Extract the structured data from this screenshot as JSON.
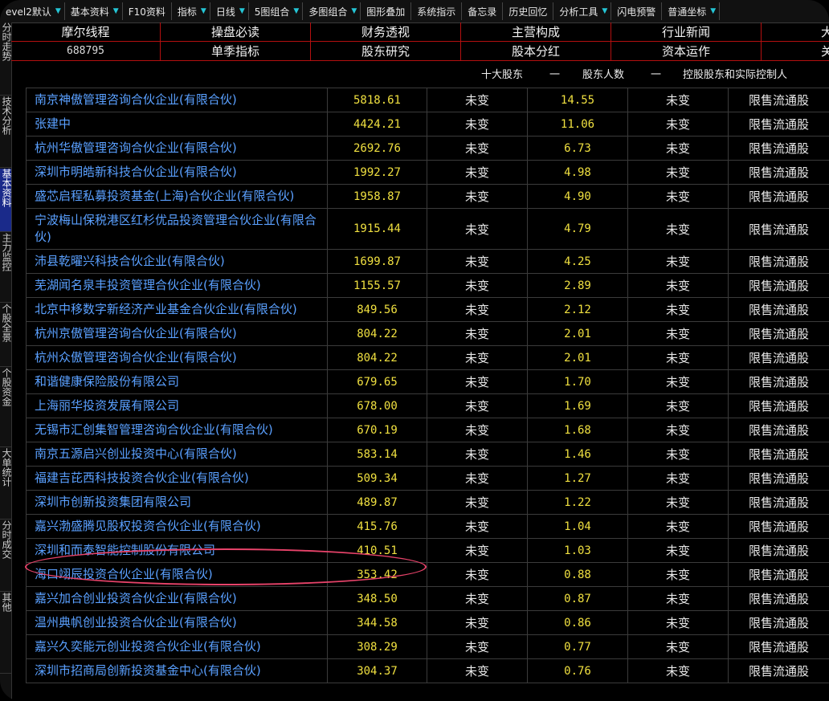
{
  "toolbar": {
    "items": [
      {
        "label": "evel2默认",
        "arrow": true
      },
      {
        "label": "基本资料",
        "arrow": true
      },
      {
        "label": "F10资料",
        "arrow": false
      },
      {
        "label": "指标",
        "arrow": true
      },
      {
        "label": "日线",
        "arrow": true
      },
      {
        "label": "5图组合",
        "arrow": true
      },
      {
        "label": "多图组合",
        "arrow": true
      },
      {
        "label": "图形叠加",
        "arrow": false
      },
      {
        "label": "系统指示",
        "arrow": false
      },
      {
        "label": "备忘录",
        "arrow": false
      },
      {
        "label": "历史回忆",
        "arrow": false
      },
      {
        "label": "分析工具",
        "arrow": true
      },
      {
        "label": "闪电预警",
        "arrow": false
      },
      {
        "label": "普通坐标",
        "arrow": true
      }
    ]
  },
  "side_tabs": [
    "分时走势",
    "技术分析",
    "基本资料",
    "主力监控",
    "个股全景",
    "个股资金",
    "大单统计",
    "分时成交",
    "其他"
  ],
  "nav": {
    "stock_name": "摩尔线程",
    "stock_code": "688795",
    "row1": [
      "操盘必读",
      "财务透视",
      "主营构成",
      "行业新闻",
      "大事"
    ],
    "row2": [
      "单季指标",
      "股东研究",
      "股本分红",
      "资本运作",
      "关联"
    ]
  },
  "subnav": {
    "items": [
      "十大股东",
      "一",
      "股东人数",
      "一",
      "控股股东和实际控制人"
    ]
  },
  "table": {
    "rows": [
      {
        "name": "南京神傲管理咨询合伙企业(有限合伙)",
        "shares": "5818.61",
        "change": "未变",
        "ratio": "14.55",
        "change2": "未变",
        "type": "限售流通股"
      },
      {
        "name": "张建中",
        "shares": "4424.21",
        "change": "未变",
        "ratio": "11.06",
        "change2": "未变",
        "type": "限售流通股"
      },
      {
        "name": "杭州华傲管理咨询合伙企业(有限合伙)",
        "shares": "2692.76",
        "change": "未变",
        "ratio": "6.73",
        "change2": "未变",
        "type": "限售流通股"
      },
      {
        "name": "深圳市明皓新科技合伙企业(有限合伙)",
        "shares": "1992.27",
        "change": "未变",
        "ratio": "4.98",
        "change2": "未变",
        "type": "限售流通股"
      },
      {
        "name": "盛芯启程私募投资基金(上海)合伙企业(有限合伙)",
        "shares": "1958.87",
        "change": "未变",
        "ratio": "4.90",
        "change2": "未变",
        "type": "限售流通股"
      },
      {
        "name": "宁波梅山保税港区红杉优品投资管理合伙企业(有限合伙)",
        "shares": "1915.44",
        "change": "未变",
        "ratio": "4.79",
        "change2": "未变",
        "type": "限售流通股"
      },
      {
        "name": "沛县乾曜兴科技合伙企业(有限合伙)",
        "shares": "1699.87",
        "change": "未变",
        "ratio": "4.25",
        "change2": "未变",
        "type": "限售流通股"
      },
      {
        "name": "芜湖闻名泉丰投资管理合伙企业(有限合伙)",
        "shares": "1155.57",
        "change": "未变",
        "ratio": "2.89",
        "change2": "未变",
        "type": "限售流通股"
      },
      {
        "name": "北京中移数字新经济产业基金合伙企业(有限合伙)",
        "shares": "849.56",
        "change": "未变",
        "ratio": "2.12",
        "change2": "未变",
        "type": "限售流通股"
      },
      {
        "name": "杭州京傲管理咨询合伙企业(有限合伙)",
        "shares": "804.22",
        "change": "未变",
        "ratio": "2.01",
        "change2": "未变",
        "type": "限售流通股"
      },
      {
        "name": "杭州众傲管理咨询合伙企业(有限合伙)",
        "shares": "804.22",
        "change": "未变",
        "ratio": "2.01",
        "change2": "未变",
        "type": "限售流通股"
      },
      {
        "name": "和谐健康保险股份有限公司",
        "shares": "679.65",
        "change": "未变",
        "ratio": "1.70",
        "change2": "未变",
        "type": "限售流通股"
      },
      {
        "name": "上海丽华投资发展有限公司",
        "shares": "678.00",
        "change": "未变",
        "ratio": "1.69",
        "change2": "未变",
        "type": "限售流通股"
      },
      {
        "name": "无锡市汇创集智管理咨询合伙企业(有限合伙)",
        "shares": "670.19",
        "change": "未变",
        "ratio": "1.68",
        "change2": "未变",
        "type": "限售流通股"
      },
      {
        "name": "南京五源启兴创业投资中心(有限合伙)",
        "shares": "583.14",
        "change": "未变",
        "ratio": "1.46",
        "change2": "未变",
        "type": "限售流通股"
      },
      {
        "name": "福建吉芘西科技投资合伙企业(有限合伙)",
        "shares": "509.34",
        "change": "未变",
        "ratio": "1.27",
        "change2": "未变",
        "type": "限售流通股"
      },
      {
        "name": "深圳市创新投资集团有限公司",
        "shares": "489.87",
        "change": "未变",
        "ratio": "1.22",
        "change2": "未变",
        "type": "限售流通股"
      },
      {
        "name": "嘉兴渤盛腾见股权投资合伙企业(有限合伙)",
        "shares": "415.76",
        "change": "未变",
        "ratio": "1.04",
        "change2": "未变",
        "type": "限售流通股"
      },
      {
        "name": "深圳和而泰智能控制股份有限公司",
        "shares": "410.51",
        "change": "未变",
        "ratio": "1.03",
        "change2": "未变",
        "type": "限售流通股"
      },
      {
        "name": "海口翊辰投资合伙企业(有限合伙)",
        "shares": "353.42",
        "change": "未变",
        "ratio": "0.88",
        "change2": "未变",
        "type": "限售流通股"
      },
      {
        "name": "嘉兴加合创业投资合伙企业(有限合伙)",
        "shares": "348.50",
        "change": "未变",
        "ratio": "0.87",
        "change2": "未变",
        "type": "限售流通股"
      },
      {
        "name": "温州典帆创业投资合伙企业(有限合伙)",
        "shares": "344.58",
        "change": "未变",
        "ratio": "0.86",
        "change2": "未变",
        "type": "限售流通股"
      },
      {
        "name": "嘉兴久奕能元创业投资合伙企业(有限合伙)",
        "shares": "308.29",
        "change": "未变",
        "ratio": "0.77",
        "change2": "未变",
        "type": "限售流通股"
      },
      {
        "name": "深圳市招商局创新投资基金中心(有限合伙)",
        "shares": "304.37",
        "change": "未变",
        "ratio": "0.76",
        "change2": "未变",
        "type": "限售流通股"
      }
    ]
  },
  "colors": {
    "nav_border": "#b41010",
    "name_text": "#5aa0ff",
    "number_text": "#f0e040",
    "highlight_ellipse": "#e8436a",
    "toolbar_arrow": "#25c6d6"
  }
}
